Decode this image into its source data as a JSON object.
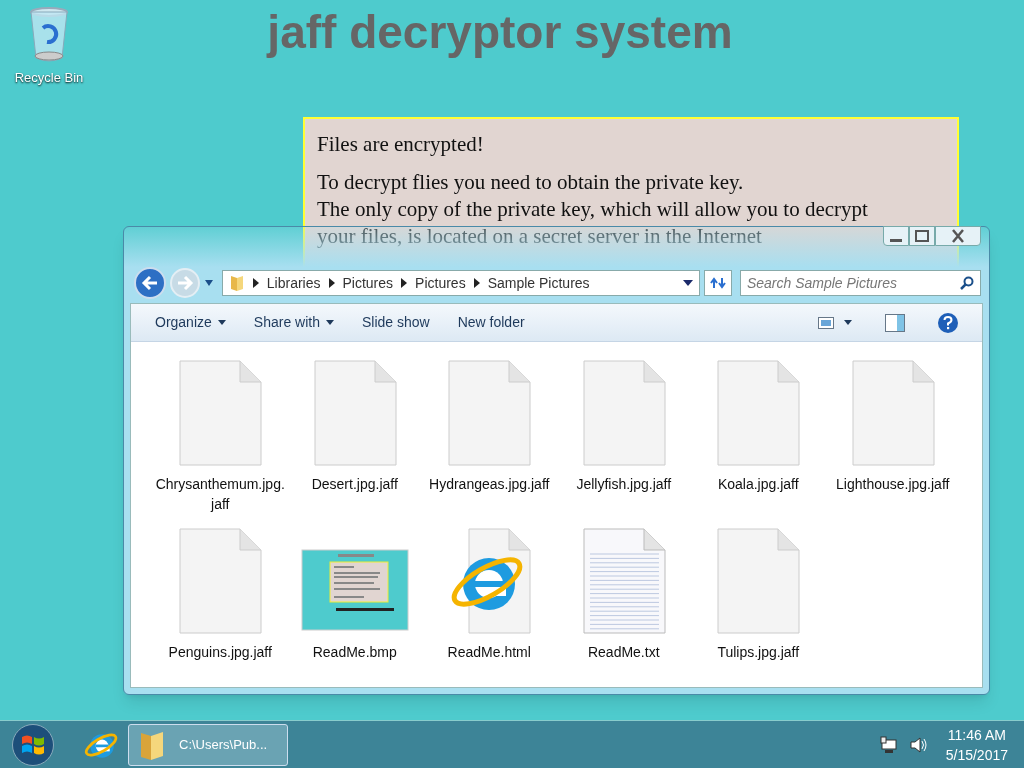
{
  "desktop": {
    "icons": [
      {
        "label": "Recycle Bin"
      }
    ],
    "wallpaper": {
      "title": "jaff decryptor system",
      "note": {
        "heading": "Files are encrypted!",
        "lines": [
          "To decrypt flies you need to obtain the private key.",
          "The only copy of the private key, which will allow you to decrypt",
          "your files, is located on a secret server in the Internet"
        ]
      }
    }
  },
  "explorer": {
    "breadcrumb": [
      "Libraries",
      "Pictures",
      "Pictures",
      "Sample Pictures"
    ],
    "search": {
      "placeholder": "Search Sample Pictures"
    },
    "toolbar": [
      {
        "label": "Organize",
        "menu": true
      },
      {
        "label": "Share with",
        "menu": true
      },
      {
        "label": "Slide show",
        "menu": false
      },
      {
        "label": "New folder",
        "menu": false
      }
    ],
    "files": [
      {
        "name": "Chrysanthemum.jpg.jaff",
        "kind": "blank"
      },
      {
        "name": "Desert.jpg.jaff",
        "kind": "blank"
      },
      {
        "name": "Hydrangeas.jpg.jaff",
        "kind": "blank"
      },
      {
        "name": "Jellyfish.jpg.jaff",
        "kind": "blank"
      },
      {
        "name": "Koala.jpg.jaff",
        "kind": "blank"
      },
      {
        "name": "Lighthouse.jpg.jaff",
        "kind": "blank"
      },
      {
        "name": "Penguins.jpg.jaff",
        "kind": "blank"
      },
      {
        "name": "ReadMe.bmp",
        "kind": "bitmap"
      },
      {
        "name": "ReadMe.html",
        "kind": "web"
      },
      {
        "name": "ReadMe.txt",
        "kind": "text"
      },
      {
        "name": "Tulips.jpg.jaff",
        "kind": "blank"
      }
    ]
  },
  "taskbar": {
    "windows": [
      {
        "label": "C:\\Users\\Pub...",
        "selected": true
      }
    ],
    "clock": {
      "time": "11:46 AM",
      "date": "5/15/2017"
    }
  }
}
